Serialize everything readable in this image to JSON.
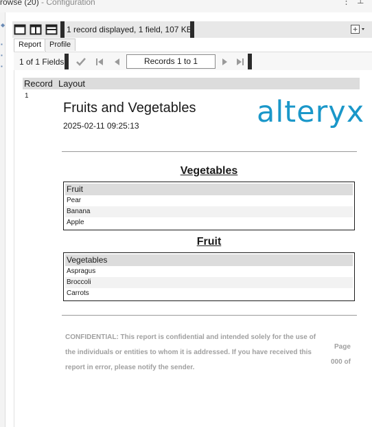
{
  "window": {
    "title_main": "rowse (20)",
    "title_sub": " - Configuration"
  },
  "toolbar": {
    "status": "1 record displayed, 1 field, 107 KB"
  },
  "tabs": [
    {
      "label": "Report",
      "active": true
    },
    {
      "label": "Profile",
      "active": false
    }
  ],
  "records_bar": {
    "fields": "1 of 1 Fields",
    "records": "Records 1 to 1"
  },
  "grid": {
    "columns": [
      "Record",
      "Layout"
    ],
    "row_number": "1"
  },
  "report": {
    "title": "Fruits and Vegetables",
    "datetime": "2025-02-11 09:25:13",
    "logo": "alteryx",
    "colors": {
      "logo": "#1a97c9",
      "footer": "#a0a0a0"
    },
    "tables": [
      {
        "section_title": "Vegetables",
        "header": "Fruit",
        "rows": [
          "Pear",
          "Banana",
          "Apple"
        ]
      },
      {
        "section_title": "Fruit",
        "header": "Vegetables",
        "rows": [
          "Aspragus",
          "Broccoli",
          "Carrots"
        ]
      }
    ],
    "footer": {
      "confidential": "CONFIDENTIAL: This report is confidential and intended solely for the use of the individuals or entities to whom it is addressed. If you have received this report in error, please notify the sender.",
      "page_label": "Page",
      "page_number": "000 of"
    }
  }
}
